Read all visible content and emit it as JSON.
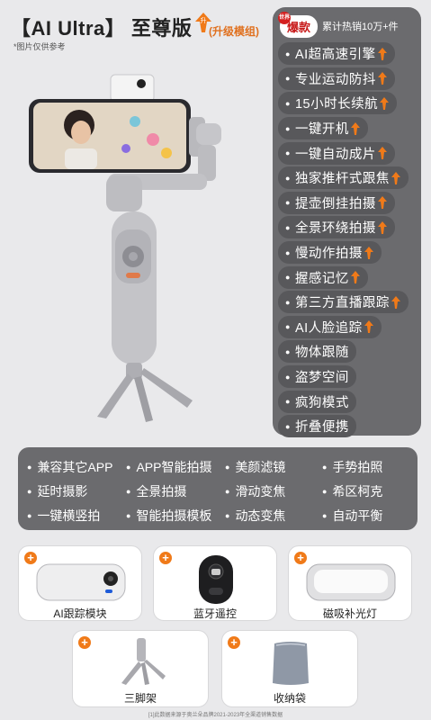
{
  "header": {
    "title": "【AI Ultra】 至尊版",
    "badge_upgrade": "升",
    "subtitle": "(升级模组)",
    "note": "*图片仅供参考"
  },
  "features": {
    "hot_tag": "爆款",
    "hot_mark": "世界",
    "hot_text": "累计热销10万+件",
    "items": [
      {
        "label": "AI超高速引擎",
        "upgrade": true
      },
      {
        "label": "专业运动防抖",
        "upgrade": true
      },
      {
        "label": "15小时长续航",
        "upgrade": true
      },
      {
        "label": "一键开机",
        "upgrade": true
      },
      {
        "label": "一键自动成片",
        "upgrade": true
      },
      {
        "label": "独家推杆式跟焦",
        "upgrade": true
      },
      {
        "label": "提壶倒挂拍摄",
        "upgrade": true
      },
      {
        "label": "全景环绕拍摄",
        "upgrade": true
      },
      {
        "label": "慢动作拍摄",
        "upgrade": true
      },
      {
        "label": "握感记忆",
        "upgrade": true
      },
      {
        "label": "第三方直播跟踪",
        "upgrade": true
      },
      {
        "label": "AI人脸追踪",
        "upgrade": true
      },
      {
        "label": "物体跟随",
        "upgrade": false
      },
      {
        "label": "盗梦空间",
        "upgrade": false
      },
      {
        "label": "疯狗模式",
        "upgrade": false
      },
      {
        "label": "折叠便携",
        "upgrade": false
      }
    ]
  },
  "modes": [
    "兼容其它APP",
    "APP智能拍摄",
    "美颜滤镜",
    "手势拍照",
    "延时摄影",
    "全景拍摄",
    "滑动变焦",
    "希区柯克",
    "一键横竖拍",
    "智能拍摄模板",
    "动态变焦",
    "自动平衡"
  ],
  "accessories": [
    {
      "name": "ai-tracking-module",
      "label": "AI跟踪模块"
    },
    {
      "name": "bluetooth-remote",
      "label": "蓝牙遥控"
    },
    {
      "name": "magnetic-fill-light",
      "label": "磁吸补光灯"
    },
    {
      "name": "tripod",
      "label": "三脚架"
    },
    {
      "name": "storage-bag",
      "label": "收纳袋"
    }
  ],
  "footer": "[1]此数据来源于奥兰朵品牌2021-2023年全渠道销售数据",
  "colors": {
    "panel": "#6b6b6e",
    "accent_orange": "#f07a19",
    "hot_red": "#d42020",
    "background": "#e9e9eb"
  }
}
